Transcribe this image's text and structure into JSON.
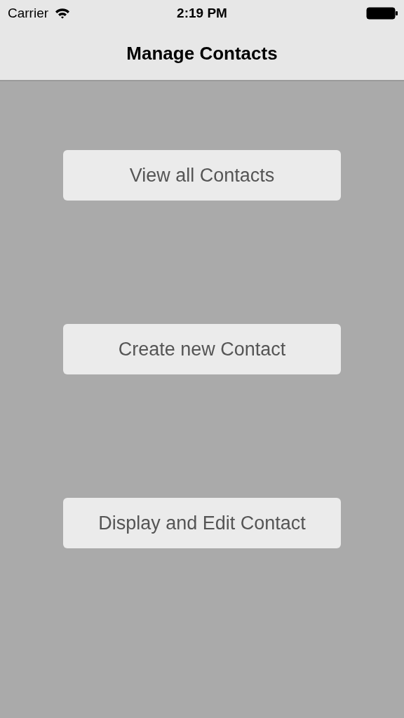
{
  "status_bar": {
    "carrier": "Carrier",
    "time": "2:19 PM"
  },
  "navigation_bar": {
    "title": "Manage Contacts"
  },
  "buttons": [
    "View all Contacts",
    "Create new Contact",
    "Display and Edit Contact"
  ]
}
